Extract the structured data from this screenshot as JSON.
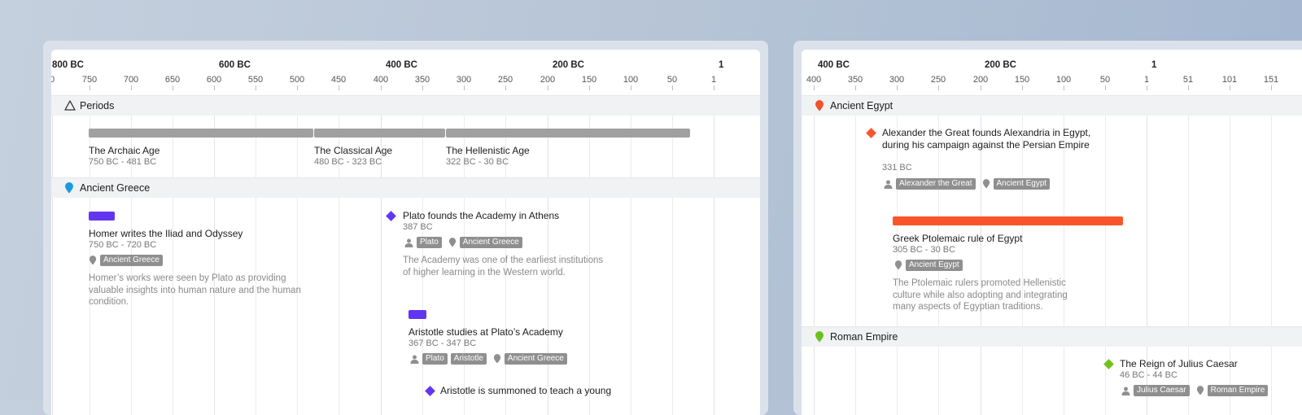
{
  "left_timeline": {
    "major_labels": [
      "800 BC",
      "600 BC",
      "400 BC",
      "200 BC",
      "1"
    ],
    "tick_labels": [
      "0",
      "750",
      "700",
      "650",
      "600",
      "550",
      "500",
      "450",
      "400",
      "350",
      "300",
      "250",
      "200",
      "150",
      "100",
      "50",
      "1"
    ],
    "groups": {
      "periods": {
        "label": "Periods",
        "icon": "triangle-icon",
        "events": [
          {
            "title": "The Archaic Age",
            "date": "750 BC - 481 BC"
          },
          {
            "title": "The Classical Age",
            "date": "480 BC - 323 BC"
          },
          {
            "title": "The Hellenistic Age",
            "date": "322 BC - 30 BC"
          }
        ]
      },
      "greece": {
        "label": "Ancient Greece",
        "color": "#1a9be0",
        "events": [
          {
            "title": "Homer writes the Iliad and Odyssey",
            "date": "750 BC - 720 BC",
            "tags": [
              "Ancient Greece"
            ],
            "description": "Homer’s works were seen by Plato as providing valuable insights into human nature and the human condition."
          },
          {
            "title": "Plato founds the Academy in Athens",
            "date": "387 BC",
            "tags": [
              "Plato",
              "Ancient Greece"
            ],
            "description": "The Academy was one of the earliest institutions of higher learning in the Western world."
          },
          {
            "title": "Aristotle studies at Plato’s Academy",
            "date": "367 BC - 347 BC",
            "tags": [
              "Plato",
              "Aristotle",
              "Ancient Greece"
            ]
          },
          {
            "title": "Aristotle is summoned to teach a young"
          }
        ]
      }
    }
  },
  "right_timeline": {
    "major_labels": [
      "400 BC",
      "200 BC",
      "1"
    ],
    "tick_labels": [
      "400",
      "350",
      "300",
      "250",
      "200",
      "150",
      "100",
      "50",
      "1",
      "51",
      "101",
      "151"
    ],
    "groups": {
      "egypt": {
        "label": "Ancient Egypt",
        "color": "#f0522a",
        "events": [
          {
            "title": "Alexander the Great founds Alexandria in Egypt, during his campaign against the Persian Empire",
            "date": "331 BC",
            "tags": [
              "Alexander the Great",
              "Ancient Egypt"
            ]
          },
          {
            "title": "Greek Ptolemaic rule of Egypt",
            "date": "305 BC - 30 BC",
            "tags": [
              "Ancient Egypt"
            ],
            "description": "The Ptolemaic rulers promoted Hellenistic culture while also adopting and integrating many aspects of Egyptian traditions."
          }
        ]
      },
      "rome": {
        "label": "Roman Empire",
        "color": "#6cc11e",
        "events": [
          {
            "title": "The Reign of Julius Caesar",
            "date": "46 BC - 44 BC",
            "tags": [
              "Julius Caesar",
              "Roman Empire"
            ]
          }
        ]
      }
    }
  },
  "colors": {
    "period_bar": "#a0a0a0",
    "greece_event": "#6236f0",
    "egypt_event": "#fa5528",
    "rome_event": "#72c21d",
    "tag_bg": "#8f8f8f"
  }
}
